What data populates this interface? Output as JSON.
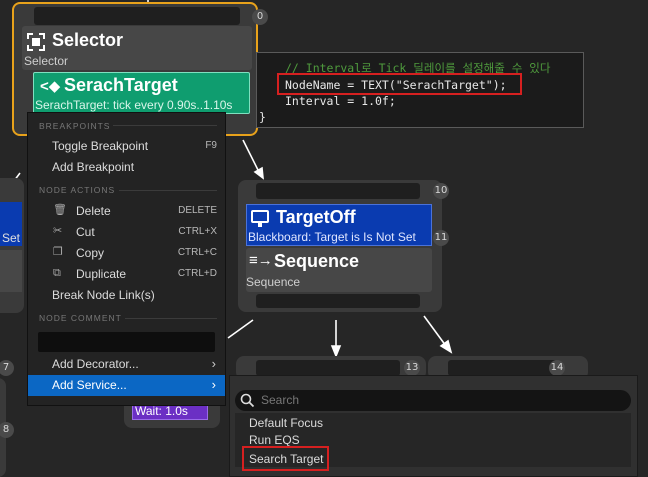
{
  "selector_node": {
    "badge": "0",
    "title": "Selector",
    "subtitle": "Selector",
    "service_title": "SerachTarget",
    "service_sub": "SerachTarget: tick every 0.90s..1.10s"
  },
  "code": {
    "line1": "// Interval로 Tick 딜레이를 설정해줄 수 있다",
    "line2": "NodeName = TEXT(\"SerachTarget\");",
    "line3": "Interval = 1.0f;",
    "brace": "}"
  },
  "right_node": {
    "badge_top": "10",
    "decorator_title": "TargetOff",
    "decorator_sub": "Blackboard: Target is Is Not Set",
    "decorator_badge": "11",
    "comp_title": "Sequence",
    "comp_sub": "Sequence"
  },
  "left_partial": {
    "text": "Set"
  },
  "bottom_nodes": {
    "badge_a": "13",
    "badge_b": "14",
    "badge_left_a": "7",
    "badge_left_b": "8"
  },
  "wait_node": {
    "label": "Wait: 1.0s"
  },
  "context_menu": {
    "breakpoints_header": "BREAKPOINTS",
    "toggle_breakpoint": "Toggle Breakpoint",
    "toggle_breakpoint_shortcut": "F9",
    "add_breakpoint": "Add Breakpoint",
    "node_actions_header": "NODE ACTIONS",
    "delete": "Delete",
    "delete_shortcut": "DELETE",
    "cut": "Cut",
    "cut_shortcut": "CTRL+X",
    "copy": "Copy",
    "copy_shortcut": "CTRL+C",
    "duplicate": "Duplicate",
    "duplicate_shortcut": "CTRL+D",
    "break_links": "Break Node Link(s)",
    "node_comment_header": "NODE COMMENT",
    "add_decorator": "Add Decorator...",
    "add_service": "Add Service..."
  },
  "service_list": {
    "search_placeholder": "Search",
    "options": [
      "Default Focus",
      "Run EQS",
      "Search Target"
    ]
  },
  "colors": {
    "selection_border": "#e8a21b",
    "service_green": "#0f9d6f",
    "decorator_blue": "#0a3bb0",
    "highlight_red": "#d62020",
    "menu_highlight": "#0b67c4",
    "wait_purple": "#6b2fc4"
  }
}
